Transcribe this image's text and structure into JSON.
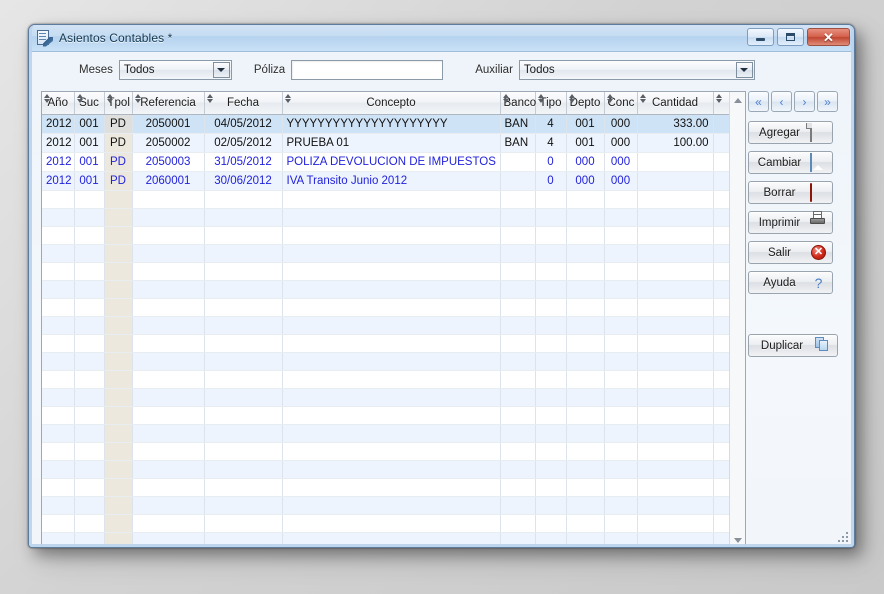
{
  "window": {
    "title": "Asientos Contables *",
    "icon": "document-edit-icon",
    "minimize_label": "Minimizar",
    "maximize_label": "Maximizar",
    "close_label": "Cerrar",
    "close_glyph": "✕"
  },
  "filters": {
    "meses_label": "Meses",
    "meses_value": "Todos",
    "poliza_label": "Póliza",
    "poliza_value": "",
    "poliza_placeholder": "",
    "auxiliar_label": "Auxiliar",
    "auxiliar_value": "Todos"
  },
  "grid": {
    "columns": [
      {
        "key": "anio",
        "label": "Año",
        "align": "center"
      },
      {
        "key": "suc",
        "label": "Suc",
        "align": "center"
      },
      {
        "key": "tpol",
        "label": "Tpol",
        "align": "center"
      },
      {
        "key": "referencia",
        "label": "Referencia",
        "align": "center"
      },
      {
        "key": "fecha",
        "label": "Fecha",
        "align": "center"
      },
      {
        "key": "concepto",
        "label": "Concepto",
        "align": "left"
      },
      {
        "key": "banco",
        "label": "Banco",
        "align": "left"
      },
      {
        "key": "tipo",
        "label": "Tipo",
        "align": "center"
      },
      {
        "key": "depto",
        "label": "Depto",
        "align": "center"
      },
      {
        "key": "conc",
        "label": "Conc",
        "align": "center"
      },
      {
        "key": "cantidad",
        "label": "Cantidad",
        "align": "right"
      },
      {
        "key": "extra",
        "label": "",
        "align": "left"
      }
    ],
    "rows": [
      {
        "anio": "2012",
        "suc": "001",
        "tpol": "PD",
        "referencia": "2050001",
        "fecha": "04/05/2012",
        "concepto": "YYYYYYYYYYYYYYYYYYYYY",
        "banco": "BAN",
        "tipo": "4",
        "depto": "001",
        "conc": "000",
        "cantidad": "333.00",
        "extra": "",
        "selected": true,
        "blue": false
      },
      {
        "anio": "2012",
        "suc": "001",
        "tpol": "PD",
        "referencia": "2050002",
        "fecha": "02/05/2012",
        "concepto": "PRUEBA 01",
        "banco": "BAN",
        "tipo": "4",
        "depto": "001",
        "conc": "000",
        "cantidad": "100.00",
        "extra": "",
        "selected": false,
        "blue": false
      },
      {
        "anio": "2012",
        "suc": "001",
        "tpol": "PD",
        "referencia": "2050003",
        "fecha": "31/05/2012",
        "concepto": "POLIZA DEVOLUCION DE IMPUESTOS",
        "banco": "",
        "tipo": "0",
        "depto": "000",
        "conc": "000",
        "cantidad": "",
        "extra": "",
        "selected": false,
        "blue": true
      },
      {
        "anio": "2012",
        "suc": "001",
        "tpol": "PD",
        "referencia": "2060001",
        "fecha": "30/06/2012",
        "concepto": "IVA Transito Junio 2012",
        "banco": "",
        "tipo": "0",
        "depto": "000",
        "conc": "000",
        "cantidad": "",
        "extra": "",
        "selected": false,
        "blue": true
      }
    ],
    "empty_row_count": 22,
    "highlight_column": "tpol"
  },
  "navigation": {
    "first_label": "«",
    "prev_label": "‹",
    "next_label": "›",
    "last_label": "»"
  },
  "actions": [
    {
      "label": "Agregar",
      "icon": "page-new-icon",
      "name": "agregar-button"
    },
    {
      "label": "Cambiar",
      "icon": "edit-image-icon",
      "name": "cambiar-button"
    },
    {
      "label": "Borrar",
      "icon": "delete-icon",
      "name": "borrar-button"
    },
    {
      "label": "Imprimir",
      "icon": "printer-icon",
      "name": "imprimir-button"
    },
    {
      "label": "Salir",
      "icon": "exit-icon",
      "name": "salir-button"
    },
    {
      "label": "Ayuda",
      "icon": "help-icon",
      "name": "ayuda-button"
    }
  ],
  "duplicate": {
    "label": "Duplicar",
    "icon": "copy-icon"
  },
  "scrollbars": {
    "h_left_label": "◀",
    "h_right_label": "▶",
    "v_up_label": "▲",
    "v_down_label": "▼"
  },
  "colors": {
    "title_gradient_top": "#d3e3f4",
    "title_gradient_bottom": "#c9e1f7",
    "row_even": "#edf4fd",
    "row_selected": "#cfe3f6",
    "highlight_column": "#ece8dd",
    "blue_text": "#2222dd",
    "close_button": "#bf4631",
    "window_border": "#5d7b9d"
  }
}
